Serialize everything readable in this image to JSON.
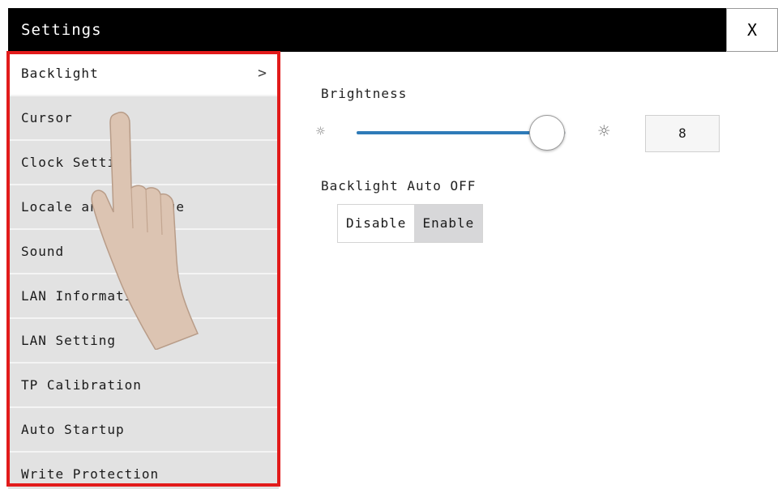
{
  "window": {
    "title": "Settings",
    "close_label": "X"
  },
  "sidebar": {
    "items": [
      {
        "label": "Backlight",
        "selected": true,
        "chevron": ">"
      },
      {
        "label": "Cursor"
      },
      {
        "label": "Clock Setting"
      },
      {
        "label": "Locale and Language"
      },
      {
        "label": "Sound"
      },
      {
        "label": "LAN Information"
      },
      {
        "label": "LAN Setting"
      },
      {
        "label": "TP Calibration"
      },
      {
        "label": "Auto Startup"
      },
      {
        "label": "Write Protection"
      }
    ]
  },
  "backlight": {
    "brightness_label": "Brightness",
    "brightness_value": "8",
    "brightness_fraction": 0.91,
    "auto_off_label": "Backlight Auto OFF",
    "auto_off_options": [
      "Disable",
      "Enable"
    ],
    "auto_off_selected": "Enable"
  },
  "icons": {
    "close": "close-icon",
    "chevron": "chevron-right-icon",
    "brightness_low": "sun-small-icon",
    "brightness_high": "sun-large-icon",
    "overlay": "pointing-hand-icon"
  },
  "colors": {
    "titlebar_bg": "#000000",
    "highlight_border": "#e21b1b",
    "slider_fill": "#2e7bb8",
    "menu_bg": "#e2e2e2",
    "active_toggle_bg": "#d7d7d9"
  }
}
